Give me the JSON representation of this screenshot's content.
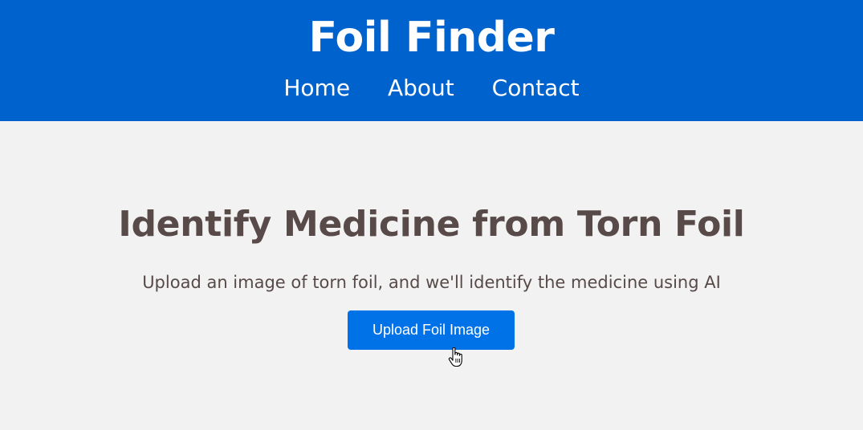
{
  "header": {
    "title": "Foil Finder",
    "nav": [
      {
        "label": "Home"
      },
      {
        "label": "About"
      },
      {
        "label": "Contact"
      }
    ],
    "background_color": "#0063cd"
  },
  "main": {
    "heading": "Identify Medicine from Torn Foil",
    "subtitle": "Upload an image of torn foil, and we'll identify the medicine using AI",
    "upload_button_label": "Upload Foil Image",
    "button_color": "#0072e8",
    "text_color": "#574a48"
  },
  "cursor": {
    "icon": "hand-pointer-icon"
  }
}
